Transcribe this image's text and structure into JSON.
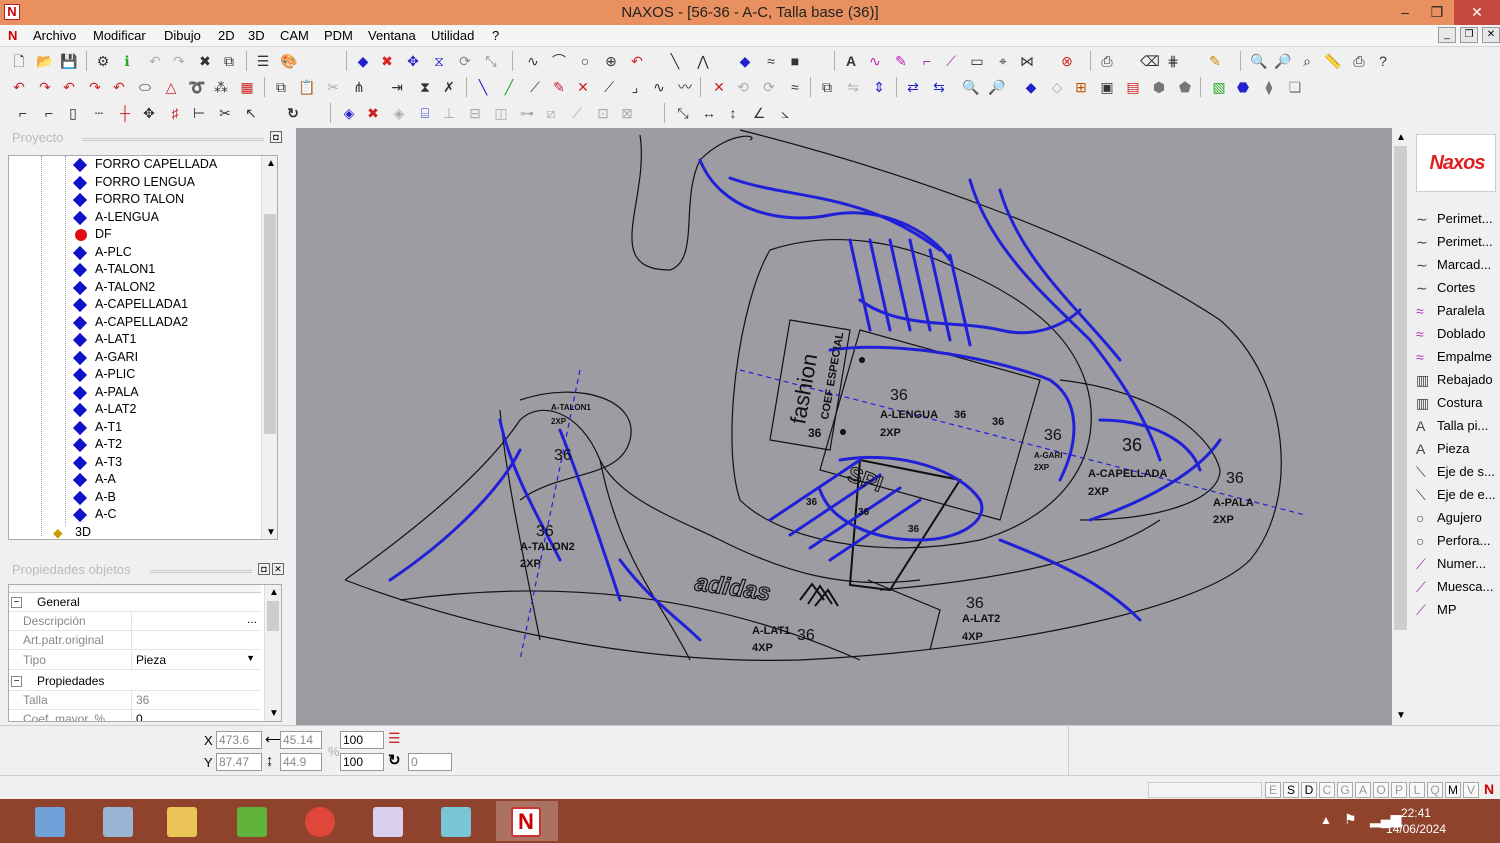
{
  "window": {
    "title": "NAXOS - [56-36 - A-C, Talla base (36)]",
    "app_icon": "N"
  },
  "menu": [
    "Archivo",
    "Modificar",
    "Dibujo",
    "2D",
    "3D",
    "CAM",
    "PDM",
    "Ventana",
    "Utilidad",
    "?"
  ],
  "project_panel": {
    "title": "Proyecto",
    "items": [
      "FORRO CAPELLADA",
      "FORRO LENGUA",
      "FORRO TALON",
      "A-LENGUA",
      "DF",
      "A-PLC",
      "A-TALON1",
      "A-TALON2",
      "A-CAPELLADA1",
      "A-CAPELLADA2",
      "A-LAT1",
      "A-GARI",
      "A-PLIC",
      "A-PALA",
      "A-LAT2",
      "A-T1",
      "A-T2",
      "A-T3",
      "A-A",
      "A-B",
      "A-C"
    ],
    "root_3d": "3D"
  },
  "properties_panel": {
    "title": "Propiedades objetos",
    "group_general": "General",
    "descripcion_label": "Descripción",
    "artpatr_label": "Art.patr.original",
    "tipo_label": "Tipo",
    "tipo_value": "Pieza",
    "group_props": "Propiedades",
    "talla_label": "Talla",
    "talla_value": "36",
    "coef_label": "Coef. mayor. %",
    "coef_value": "0",
    "ellipsis": "..."
  },
  "canvas": {
    "labels": {
      "talon1": "A-TALON1",
      "talon1_qty": "2XP",
      "talon2": "A-TALON2",
      "talon2_qty": "2XP",
      "lengua": "A-LENGUA",
      "lengua_qty": "2XP",
      "capellada": "A-CAPELLADA",
      "capellada_qty": "2XP",
      "gari": "A-GARI",
      "gari_qty": "2XP",
      "pala": "A-PALA",
      "pala_qty": "2XP",
      "lat1": "A-LAT1",
      "lat1_qty": "4XP",
      "lat2": "A-LAT2",
      "lat2_qty": "4XP",
      "size": "36",
      "fashion": "fashion",
      "coef": "COEF ESPECIAL",
      "brand": "adidas",
      "spi": "SPI"
    }
  },
  "right_panel": {
    "logo": "Naxos",
    "items": [
      {
        "icon": "curve-icon",
        "label": "Perimet..."
      },
      {
        "icon": "curve-icon",
        "label": "Perimet..."
      },
      {
        "icon": "curve-icon",
        "label": "Marcad..."
      },
      {
        "icon": "curve-icon",
        "label": "Cortes"
      },
      {
        "icon": "parallel-icon",
        "label": "Paralela"
      },
      {
        "icon": "fold-icon",
        "label": "Doblado"
      },
      {
        "icon": "join-icon",
        "label": "Empalme"
      },
      {
        "icon": "skive-icon",
        "label": "Rebajado"
      },
      {
        "icon": "stitch-icon",
        "label": "Costura"
      },
      {
        "icon": "text-icon",
        "label": "Talla pi..."
      },
      {
        "icon": "text-icon",
        "label": "Pieza"
      },
      {
        "icon": "axis-icon",
        "label": "Eje de s..."
      },
      {
        "icon": "axis-icon",
        "label": "Eje de e..."
      },
      {
        "icon": "circle-icon",
        "label": "Agujero"
      },
      {
        "icon": "circle-icon",
        "label": "Perfora..."
      },
      {
        "icon": "number-icon",
        "label": "Numer..."
      },
      {
        "icon": "notch-icon",
        "label": "Muesca..."
      },
      {
        "icon": "mp-icon",
        "label": "MP"
      }
    ]
  },
  "coords": {
    "x_label": "X",
    "y_label": "Y",
    "x": "473.6",
    "y": "87.47",
    "w": "45.14",
    "h": "44.9",
    "scale_x": "100",
    "scale_y": "100",
    "pct": "%",
    "rot": "0"
  },
  "status_letters": [
    "E",
    "S",
    "D",
    "C",
    "G",
    "A",
    "O",
    "P",
    "L",
    "Q",
    "M",
    "V"
  ],
  "clock": {
    "time": "22:41",
    "date": "14/06/2024"
  }
}
